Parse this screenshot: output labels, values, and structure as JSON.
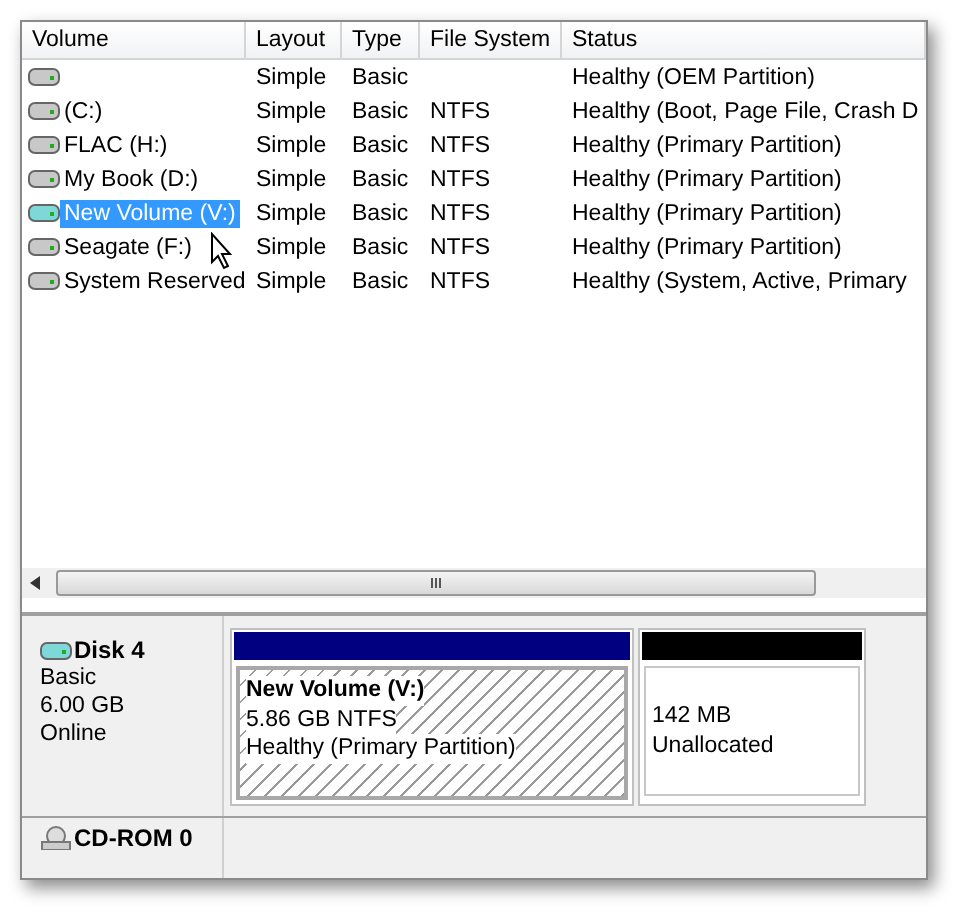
{
  "table": {
    "columns": [
      "Volume",
      "Layout",
      "Type",
      "File System",
      "Status"
    ],
    "rows": [
      {
        "volume": "",
        "layout": "Simple",
        "type": "Basic",
        "file_system": "",
        "status": "Healthy (OEM Partition)",
        "selected": false
      },
      {
        "volume": " (C:)",
        "layout": "Simple",
        "type": "Basic",
        "file_system": "NTFS",
        "status": "Healthy (Boot, Page File, Crash D",
        "selected": false
      },
      {
        "volume": "FLAC (H:)",
        "layout": "Simple",
        "type": "Basic",
        "file_system": "NTFS",
        "status": "Healthy (Primary Partition)",
        "selected": false
      },
      {
        "volume": "My Book (D:)",
        "layout": "Simple",
        "type": "Basic",
        "file_system": "NTFS",
        "status": "Healthy (Primary Partition)",
        "selected": false
      },
      {
        "volume": "New Volume (V:)",
        "layout": "Simple",
        "type": "Basic",
        "file_system": "NTFS",
        "status": "Healthy (Primary Partition)",
        "selected": true
      },
      {
        "volume": "Seagate (F:)",
        "layout": "Simple",
        "type": "Basic",
        "file_system": "NTFS",
        "status": "Healthy (Primary Partition)",
        "selected": false
      },
      {
        "volume": "System Reserved",
        "layout": "Simple",
        "type": "Basic",
        "file_system": "NTFS",
        "status": "Healthy (System, Active, Primary",
        "selected": false
      }
    ]
  },
  "disks": [
    {
      "name": "Disk 4",
      "kind": "disk",
      "type": "Basic",
      "size": "6.00 GB",
      "state": "Online",
      "partitions": [
        {
          "kind": "primary",
          "title": "New Volume  (V:)",
          "size": "5.86 GB NTFS",
          "status": "Healthy (Primary Partition)",
          "selected": true
        },
        {
          "kind": "unallocated",
          "size": "142 MB",
          "status": "Unallocated",
          "selected": false
        }
      ]
    },
    {
      "name": "CD-ROM 0",
      "kind": "cdrom"
    }
  ]
}
